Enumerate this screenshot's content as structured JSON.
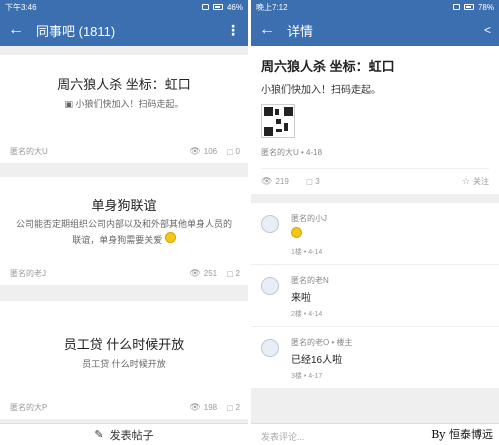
{
  "left": {
    "status": {
      "time": "下午3:46",
      "battery": "46%"
    },
    "header": {
      "title": "同事吧 (1811)",
      "back_icon": "back-arrow-icon",
      "menu_icon": "more-vert-icon"
    },
    "posts": [
      {
        "title": "周六狼人杀 坐标：虹口",
        "body": "小狼们快加入！扫码走起。",
        "author": "匿名的大U",
        "views": "106",
        "comments": "0"
      },
      {
        "title": "单身狗联谊",
        "body": "公司能否定期组织公司内部以及和外部其他单身人员的联谊，单身狗需要关爱",
        "author": "匿名的老J",
        "views": "251",
        "comments": "2"
      },
      {
        "title": "员工贷 什么时候开放",
        "body": "员工贷 什么时候开放",
        "author": "匿名的大P",
        "views": "198",
        "comments": "2"
      }
    ],
    "compose": {
      "label": "发表帖子"
    }
  },
  "right": {
    "status": {
      "time": "晚上7:12",
      "battery": "78%"
    },
    "header": {
      "title": "详情",
      "back_icon": "back-arrow-icon",
      "share_icon": "share-icon"
    },
    "detail": {
      "title": "周六狼人杀 坐标：虹口",
      "body": "小狼们快加入！扫码走起。",
      "author_line": "匿名的大U • 4-18",
      "views": "219",
      "comments": "3",
      "follow": "关注"
    },
    "comments": [
      {
        "name": "匿名的小J",
        "text": "",
        "meta": "1楼 • 4-14"
      },
      {
        "name": "匿名的老N",
        "text": "来啦",
        "meta": "2楼 • 4-14"
      },
      {
        "name": "匿名的老O • 楼主",
        "text": "已经16人啦",
        "meta": "3楼 • 4-17"
      }
    ],
    "input": {
      "placeholder": "发表评论..."
    },
    "watermark": "By 恒泰博远"
  },
  "colors": {
    "appbar": "#3b6fb0",
    "background": "#efefef"
  }
}
